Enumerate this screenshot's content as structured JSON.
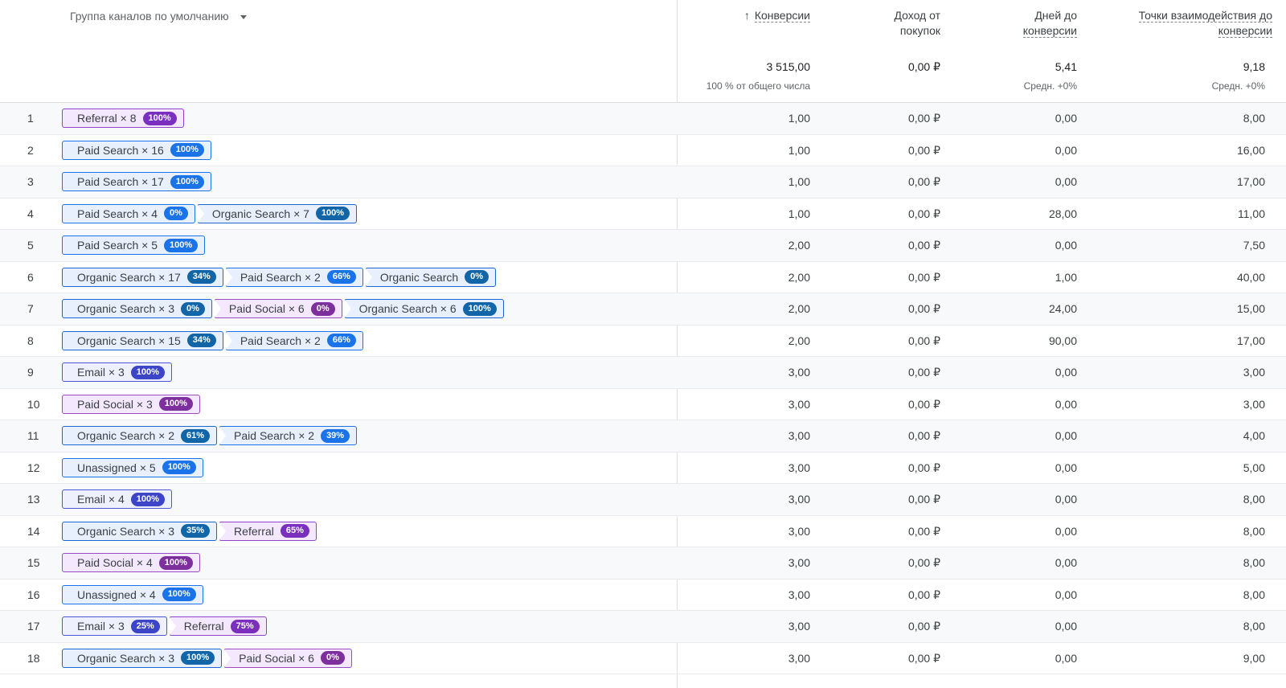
{
  "header": {
    "dimension": "Группа каналов по умолчанию",
    "conversions": "Конверсии",
    "revenue_line1": "Доход от",
    "revenue_line2": "покупок",
    "days_line1": "Дней до",
    "days_line2": "конверсии",
    "touch_line1": "Точки взаимодействия до",
    "touch_line2": "конверсии"
  },
  "totals": {
    "conversions": "3 515,00",
    "conversions_sub": "100 % от общего числа",
    "revenue": "0,00 ₽",
    "days": "5,41",
    "days_sub": "Средн. +0%",
    "touch": "9,18",
    "touch_sub": "Средн. +0%"
  },
  "colors": {
    "Organic Search": "#1266a8",
    "Paid Search": "#1a73e8",
    "Referral": "#7b2fbf",
    "Email": "#3c44c8",
    "Paid Social": "#7d2f9e",
    "Unassigned": "#1a73e8"
  },
  "rows": [
    {
      "n": "1",
      "path": [
        {
          "name": "Referral × 8",
          "pct": "100%"
        }
      ],
      "conv": "1,00",
      "rev": "0,00 ₽",
      "days": "0,00",
      "touch": "8,00"
    },
    {
      "n": "2",
      "path": [
        {
          "name": "Paid Search × 16",
          "pct": "100%"
        }
      ],
      "conv": "1,00",
      "rev": "0,00 ₽",
      "days": "0,00",
      "touch": "16,00"
    },
    {
      "n": "3",
      "path": [
        {
          "name": "Paid Search × 17",
          "pct": "100%"
        }
      ],
      "conv": "1,00",
      "rev": "0,00 ₽",
      "days": "0,00",
      "touch": "17,00"
    },
    {
      "n": "4",
      "path": [
        {
          "name": "Paid Search × 4",
          "pct": "0%"
        },
        {
          "name": "Organic Search × 7",
          "pct": "100%"
        }
      ],
      "conv": "1,00",
      "rev": "0,00 ₽",
      "days": "28,00",
      "touch": "11,00"
    },
    {
      "n": "5",
      "path": [
        {
          "name": "Paid Search × 5",
          "pct": "100%"
        }
      ],
      "conv": "2,00",
      "rev": "0,00 ₽",
      "days": "0,00",
      "touch": "7,50"
    },
    {
      "n": "6",
      "path": [
        {
          "name": "Organic Search × 17",
          "pct": "34%"
        },
        {
          "name": "Paid Search × 2",
          "pct": "66%"
        },
        {
          "name": "Organic Search",
          "pct": "0%"
        }
      ],
      "conv": "2,00",
      "rev": "0,00 ₽",
      "days": "1,00",
      "touch": "40,00"
    },
    {
      "n": "7",
      "path": [
        {
          "name": "Organic Search × 3",
          "pct": "0%"
        },
        {
          "name": "Paid Social × 6",
          "pct": "0%"
        },
        {
          "name": "Organic Search × 6",
          "pct": "100%"
        }
      ],
      "conv": "2,00",
      "rev": "0,00 ₽",
      "days": "24,00",
      "touch": "15,00"
    },
    {
      "n": "8",
      "path": [
        {
          "name": "Organic Search × 15",
          "pct": "34%"
        },
        {
          "name": "Paid Search × 2",
          "pct": "66%"
        }
      ],
      "conv": "2,00",
      "rev": "0,00 ₽",
      "days": "90,00",
      "touch": "17,00"
    },
    {
      "n": "9",
      "path": [
        {
          "name": "Email × 3",
          "pct": "100%"
        }
      ],
      "conv": "3,00",
      "rev": "0,00 ₽",
      "days": "0,00",
      "touch": "3,00"
    },
    {
      "n": "10",
      "path": [
        {
          "name": "Paid Social × 3",
          "pct": "100%"
        }
      ],
      "conv": "3,00",
      "rev": "0,00 ₽",
      "days": "0,00",
      "touch": "3,00"
    },
    {
      "n": "11",
      "path": [
        {
          "name": "Organic Search × 2",
          "pct": "61%"
        },
        {
          "name": "Paid Search × 2",
          "pct": "39%"
        }
      ],
      "conv": "3,00",
      "rev": "0,00 ₽",
      "days": "0,00",
      "touch": "4,00"
    },
    {
      "n": "12",
      "path": [
        {
          "name": "Unassigned × 5",
          "pct": "100%"
        }
      ],
      "conv": "3,00",
      "rev": "0,00 ₽",
      "days": "0,00",
      "touch": "5,00"
    },
    {
      "n": "13",
      "path": [
        {
          "name": "Email × 4",
          "pct": "100%"
        }
      ],
      "conv": "3,00",
      "rev": "0,00 ₽",
      "days": "0,00",
      "touch": "8,00"
    },
    {
      "n": "14",
      "path": [
        {
          "name": "Organic Search × 3",
          "pct": "35%"
        },
        {
          "name": "Referral",
          "pct": "65%"
        }
      ],
      "conv": "3,00",
      "rev": "0,00 ₽",
      "days": "0,00",
      "touch": "8,00"
    },
    {
      "n": "15",
      "path": [
        {
          "name": "Paid Social × 4",
          "pct": "100%"
        }
      ],
      "conv": "3,00",
      "rev": "0,00 ₽",
      "days": "0,00",
      "touch": "8,00"
    },
    {
      "n": "16",
      "path": [
        {
          "name": "Unassigned × 4",
          "pct": "100%"
        }
      ],
      "conv": "3,00",
      "rev": "0,00 ₽",
      "days": "0,00",
      "touch": "8,00"
    },
    {
      "n": "17",
      "path": [
        {
          "name": "Email × 3",
          "pct": "25%"
        },
        {
          "name": "Referral",
          "pct": "75%"
        }
      ],
      "conv": "3,00",
      "rev": "0,00 ₽",
      "days": "0,00",
      "touch": "8,00"
    },
    {
      "n": "18",
      "path": [
        {
          "name": "Organic Search × 3",
          "pct": "100%"
        },
        {
          "name": "Paid Social × 6",
          "pct": "0%"
        }
      ],
      "conv": "3,00",
      "rev": "0,00 ₽",
      "days": "0,00",
      "touch": "9,00"
    }
  ]
}
